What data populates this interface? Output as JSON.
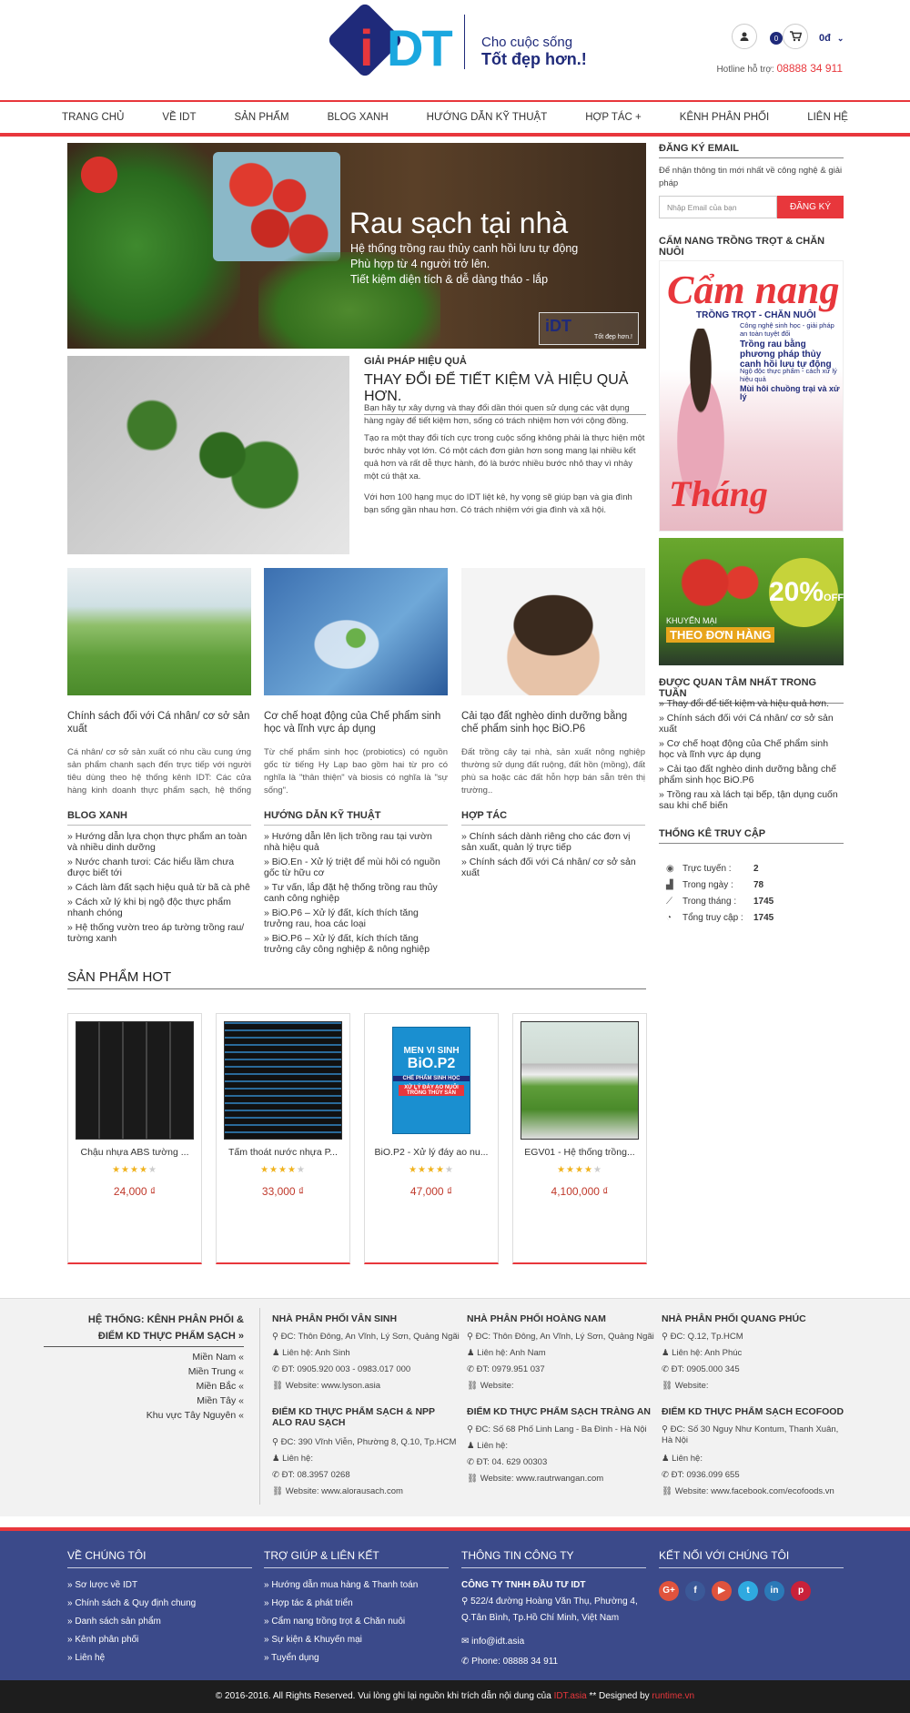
{
  "header": {
    "logo_i": "i",
    "logo_dt": "DT",
    "slogan_line1": "Cho cuộc sống",
    "slogan_line2": "Tốt đẹp hơn.!",
    "cart_count": "0",
    "cart_total": "0đ",
    "hotline_label": "Hotline hỗ trợ:",
    "hotline_number": "08888 34 911"
  },
  "nav": {
    "items": [
      "TRANG CHỦ",
      "VỀ IDT",
      "SẢN PHẨM",
      "BLOG XANH",
      "HƯỚNG DẪN KỸ THUẬT",
      "HỢP TÁC +",
      "KÊNH PHÂN PHỐI",
      "LIÊN HỆ"
    ]
  },
  "banner": {
    "title": "Rau sạch tại nhà",
    "lines": [
      "Hệ thống trồng rau thủy canh hồi lưu tự động",
      "Phù hợp từ 4 người trở lên.",
      "Tiết kiệm diện tích & dễ dàng tháo - lắp"
    ],
    "logo_text": "iDT",
    "logo_tagline": "Tốt đẹp hơn.!"
  },
  "solution": {
    "subtitle": "GIẢI PHÁP HIỆU QUẢ",
    "title": "THAY ĐỔI ĐỂ TIẾT KIỆM VÀ HIỆU QUẢ HƠN.",
    "paragraphs": [
      "Bạn hãy tự xây dựng và thay đổi dần thói quen sử dụng các vật dụng hàng ngày để tiết kiệm hơn, sống có trách nhiệm hơn với cộng đồng.",
      "Tạo ra một thay đổi tích cực trong cuộc sống không phải là thực hiện một bước nhảy vọt lớn. Có một cách đơn giản hơn song mang lại nhiều kết quả hơn và rất dễ thực hành, đó là bước nhiều bước nhỏ thay vì nhảy một cú thật xa.",
      "Với hơn 100 hạng mục do IDT liệt kê, hy vọng sẽ giúp bạn và gia đình bạn sống gần nhau hơn. Có trách nhiệm với gia đình và xã hội."
    ]
  },
  "cards": [
    {
      "title": "Chính sách đối với Cá nhân/ cơ sở sản xuất",
      "desc": "Cá nhân/ cơ sở sản xuất có nhu cầu cung ứng sản phẩm chanh sạch đến trực tiếp với người tiêu dùng theo hệ thống kênh IDT: Các cửa hàng kinh doanh thực phẩm sạch, hệ thống siêu"
    },
    {
      "title": "Cơ chế hoạt động của Chế phẩm sinh học và lĩnh vực áp dụng",
      "desc": "Từ chế phẩm sinh học (probiotics) có nguồn gốc từ tiếng Hy Lạp bao gồm hai từ pro có nghĩa là \"thân thiện\" và biosis có nghĩa là \"sự sống\"."
    },
    {
      "title": "Cải tạo đất nghèo dinh dưỡng bằng chế phẩm sinh học BiO.P6",
      "desc": "Đất trồng cây tại nhà, sản xuất nông nghiệp thường sử dụng đất ruộng, đất hồn (mồng), đất phù sa hoặc các đất hỗn hợp bán sẵn trên thị trường.."
    }
  ],
  "lists": [
    {
      "heading": "BLOG XANH",
      "items": [
        "Hướng dẫn lựa chọn thực phẩm an toàn và nhiều dinh dưỡng",
        "Nước chanh tươi: Các hiểu lầm chưa được biết tới",
        "Cách làm đất sạch hiệu quả từ bã cà phê",
        "Cách xử lý khi bị ngộ độc thực phẩm nhanh chóng",
        "Hệ thống vườn treo áp tường trồng rau/ tường xanh"
      ]
    },
    {
      "heading": "HƯỚNG DẪN KỸ THUẬT",
      "items": [
        "Hướng dẫn lên lịch trồng rau tại vườn nhà hiệu quả",
        "BiO.En - Xử lý triệt để mùi hôi có nguồn gốc từ hữu cơ",
        "Tư vấn, lắp đặt hệ thống trồng rau thủy canh công nghiệp",
        "BiO.P6 – Xử lý đất, kích thích tăng trưởng rau, hoa các loại",
        "BiO.P6 – Xử lý đất, kích thích tăng trưởng cây công nghiệp & nông nghiệp"
      ]
    },
    {
      "heading": "HỢP TÁC",
      "items": [
        "Chính sách dành riêng cho các đơn vị sản xuất, quản lý trực tiếp",
        "Chính sách đối với Cá nhân/ cơ sở sản xuất"
      ]
    }
  ],
  "hot": {
    "heading": "SẢN PHẨM HOT",
    "products": [
      {
        "name": "Chậu nhựa ABS tường ...",
        "price": "24,000 ₫",
        "rating": 4
      },
      {
        "name": "Tấm thoát nước nhựa P...",
        "price": "33,000 ₫",
        "rating": 4
      },
      {
        "name": "BiO.P2 - Xử lý đáy ao nu...",
        "price": "47,000 ₫",
        "rating": 4
      },
      {
        "name": "EGV01 - Hệ thống trồng...",
        "price": "4,100,000 ₫",
        "rating": 4
      }
    ],
    "bio_label1": "MEN VI SINH",
    "bio_label2": "BiO.P2",
    "bio_label3": "CHẾ PHẨM SINH HỌC",
    "bio_label4": "XỬ LÝ ĐÁY AO NUÔI TRỒNG THỦY SẢN"
  },
  "sidebar": {
    "email_heading": "ĐĂNG KÝ EMAIL",
    "email_desc": "Để nhận thông tin mới nhất về công nghệ & giải pháp",
    "email_placeholder": "Nhập Email của bạn",
    "email_button": "ĐĂNG KÝ",
    "handbook_heading": "CẨM NANG TRỒNG TRỌT & CHĂN NUÔI",
    "handbook_title": "Cẩm nang",
    "handbook_sub": "TRỒNG TRỌT - CHĂN NUÔI",
    "handbook_lines": [
      "Công nghệ sinh học - giải pháp an toàn tuyệt đối",
      "Trồng rau bằng phương pháp thủy canh hồi lưu tự động",
      "Ngộ độc thực phẩm - cách xử lý hiệu quả",
      "Mùi hôi chuồng trại và xử lý"
    ],
    "handbook_month": "Tháng",
    "promo_percent": "20%",
    "promo_off": "OFF",
    "promo_km": "KHUYẾN MẠI",
    "promo_title": "THEO ĐƠN HÀNG",
    "popular_heading": "ĐƯỢC QUAN TÂM NHẤT TRONG TUẦN",
    "popular": [
      "Thay đổi để tiết kiệm và hiệu quả hơn.",
      "Chính sách đối với Cá nhân/ cơ sở sản xuất",
      "Cơ chế hoạt động của Chế phẩm sinh học và lĩnh vực áp dụng",
      "Cải tạo đất nghèo dinh dưỡng bằng chế phẩm sinh học BiO.P6",
      "Trồng rau xà lách tại bếp, tận dụng cuốn sau khi chế biến"
    ],
    "stats_heading": "THỐNG KÊ TRUY CẬP",
    "stats": [
      {
        "label": "Trực tuyến :",
        "value": "2"
      },
      {
        "label": "Trong ngày :",
        "value": "78"
      },
      {
        "label": "Trong tháng :",
        "value": "1745"
      },
      {
        "label": "Tổng truy cập :",
        "value": "1745"
      }
    ]
  },
  "distributors": {
    "heading_line1": "HỆ THỐNG: KÊNH PHÂN PHỐI &",
    "heading_line2": "ĐIỂM KD THỰC PHẨM SẠCH »",
    "regions": [
      "Miền Nam «",
      "Miền Trung «",
      "Miền Bắc «",
      "Miền Tây «",
      "Khu vực Tây Nguyên «"
    ],
    "entries": [
      {
        "name": "NHÀ PHÂN PHỐI VÂN SINH",
        "lines": [
          "ĐC: Thôn Đông, An Vĩnh, Lý Sơn, Quảng Ngãi",
          "Liên hệ: Anh Sinh",
          "ĐT: 0905.920 003 - 0983.017 000",
          "Website: www.lyson.asia"
        ]
      },
      {
        "name": "NHÀ PHÂN PHỐI HOÀNG NAM",
        "lines": [
          "ĐC: Thôn Đông, An Vĩnh, Lý Sơn, Quảng Ngãi",
          "Liên hệ: Anh Nam",
          "ĐT: 0979.951 037",
          "Website:"
        ]
      },
      {
        "name": "NHÀ PHÂN PHỐI QUANG PHÚC",
        "lines": [
          "ĐC: Q.12, Tp.HCM",
          "Liên hệ: Anh Phúc",
          "ĐT: 0905.000 345",
          "Website:"
        ]
      },
      {
        "name": "ĐIỂM KD THỰC PHẨM SẠCH & NPP ALO RAU SẠCH",
        "lines": [
          "ĐC: 390 Vĩnh Viễn, Phường 8, Q.10, Tp.HCM",
          "Liên hệ:",
          "ĐT: 08.3957 0268",
          "Website: www.alorausach.com"
        ]
      },
      {
        "name": "ĐIỂM KD THỰC PHẨM SẠCH TRÀNG AN",
        "lines": [
          "ĐC: Số 68 Phố Linh Lang - Ba Đình - Hà Nội",
          "Liên hệ:",
          "ĐT: 04. 629 00303",
          "Website: www.rautrwangan.com"
        ]
      },
      {
        "name": "ĐIỂM KD THỰC PHẨM SẠCH ECOFOOD",
        "lines": [
          "ĐC: Số 30 Nguy Như Kontum, Thanh Xuân, Hà Nội",
          "Liên hệ:",
          "ĐT: 0936.099 655",
          "Website: www.facebook.com/ecofoods.vn"
        ]
      }
    ]
  },
  "footer": {
    "cols": [
      {
        "heading": "VỀ CHÚNG TÔI",
        "items": [
          "Sơ lược về IDT",
          "Chính sách & Quy định chung",
          "Danh sách sản phẩm",
          "Kênh phân phối",
          "Liên hệ"
        ]
      },
      {
        "heading": "TRỢ GIÚP & LIÊN KẾT",
        "items": [
          "Hướng dẫn mua hàng & Thanh toán",
          "Hợp tác & phát triển",
          "Cẩm nang trồng trọt & Chăn nuôi",
          "Sự kiện & Khuyến mại",
          "Tuyển dụng"
        ]
      }
    ],
    "company_heading": "THÔNG TIN CÔNG TY",
    "company_name": "CÔNG TY TNHH ĐẦU TƯ IDT",
    "company_addr1": "522/4 đường Hoàng Văn Thụ, Phường 4,",
    "company_addr2": "Q.Tân Bình, Tp.Hồ Chí Minh, Việt Nam",
    "company_email": "info@idt.asia",
    "company_phone": "Phone: 08888 34 911",
    "social_heading": "KẾT NỐI VỚI CHÚNG TÔI",
    "social": [
      {
        "name": "google-plus",
        "glyph": "G+",
        "color": "#e0533d"
      },
      {
        "name": "facebook",
        "glyph": "f",
        "color": "#3b5998"
      },
      {
        "name": "youtube",
        "glyph": "▶",
        "color": "#e0533d"
      },
      {
        "name": "twitter",
        "glyph": "t",
        "color": "#2fa9e0"
      },
      {
        "name": "linkedin",
        "glyph": "in",
        "color": "#2b7ab8"
      },
      {
        "name": "pinterest",
        "glyph": "p",
        "color": "#c9213a"
      }
    ]
  },
  "copyright": {
    "prefix": "© 2016-2016. All Rights Reserved. Vui lòng ghi lại nguồn khi trích dẫn nội dung của ",
    "site": "IDT.asia",
    "mid": " ** Designed by ",
    "designer": "runtime.vn"
  },
  "colors": {
    "accent": "#e8373c",
    "brand": "#1f2a7a",
    "footer": "#3b4a8a"
  }
}
